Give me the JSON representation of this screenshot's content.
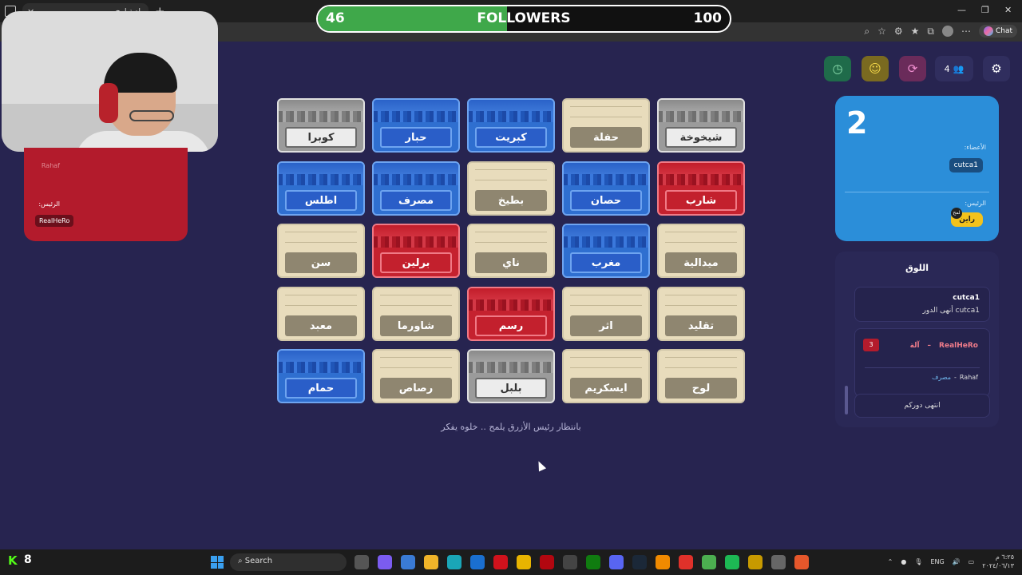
{
  "browser": {
    "tab_title": "لعبة لمح",
    "chat_label": "Chat"
  },
  "followers": {
    "current": "46",
    "label": "FOLLOWERS",
    "goal": "100",
    "progress": 0.46
  },
  "red_team": {
    "member": "Rahaf",
    "boss_label": "الرئيس:",
    "boss": "RealHeRo"
  },
  "toolbar": {
    "player_count": "4"
  },
  "blue_team": {
    "score": "2",
    "members_label": "الأعضاء:",
    "member": "cutca1",
    "boss_label": "الرئيس:",
    "boss": "راين",
    "boss_badge": "لمح"
  },
  "log": {
    "title": "اللوق",
    "entries": [
      {
        "who": "cutca1",
        "msg": "cutca1 أنهى الدور"
      },
      {
        "boss": "RealHeRo",
        "dash": "–",
        "hint": "آلة",
        "count": "3",
        "player": "Rahaf",
        "word": "مصرف"
      },
      {
        "msg": "انتهى دوركم"
      }
    ]
  },
  "cards": [
    {
      "word": "كوبرا",
      "team": "grey"
    },
    {
      "word": "حبار",
      "team": "blue"
    },
    {
      "word": "كبريت",
      "team": "blue"
    },
    {
      "word": "حفلة",
      "team": "neutral"
    },
    {
      "word": "شيخوخة",
      "team": "grey"
    },
    {
      "word": "اطلس",
      "team": "blue"
    },
    {
      "word": "مصرف",
      "team": "blue"
    },
    {
      "word": "بطيخ",
      "team": "neutral"
    },
    {
      "word": "حصان",
      "team": "blue"
    },
    {
      "word": "شارب",
      "team": "red"
    },
    {
      "word": "سن",
      "team": "neutral"
    },
    {
      "word": "برلين",
      "team": "red"
    },
    {
      "word": "ناي",
      "team": "neutral"
    },
    {
      "word": "مغرب",
      "team": "blue"
    },
    {
      "word": "ميدالية",
      "team": "neutral"
    },
    {
      "word": "معبد",
      "team": "neutral"
    },
    {
      "word": "شاورما",
      "team": "neutral"
    },
    {
      "word": "رسم",
      "team": "red"
    },
    {
      "word": "اثر",
      "team": "neutral"
    },
    {
      "word": "تقليد",
      "team": "neutral"
    },
    {
      "word": "حمام",
      "team": "blue"
    },
    {
      "word": "رصاص",
      "team": "neutral"
    },
    {
      "word": "بلبل",
      "team": "grey"
    },
    {
      "word": "ايسكريم",
      "team": "neutral"
    },
    {
      "word": "لوح",
      "team": "neutral"
    }
  ],
  "status_text": "بانتظار رئيس الأزرق يلمح .. خلوه يفكر",
  "taskbar": {
    "kick_logo": "K",
    "kick_count": "8",
    "search_label": "Search",
    "lang": "ENG",
    "time": "٦:٢٥ م",
    "date": "٢٠٢٤/٠٦/١٣"
  }
}
